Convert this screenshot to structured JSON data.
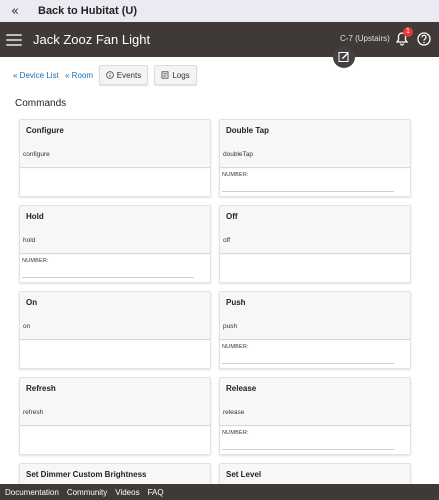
{
  "back_bar": {
    "label": "Back to Hubitat (U)",
    "icon": "chevrons-left-icon"
  },
  "header": {
    "title": "Jack Zooz Fan Light",
    "hub_name": "C-7 (Upstairs)",
    "notification_count": "1",
    "colors": {
      "bar": "#3f3a37",
      "badge": "#e53935"
    }
  },
  "nav": {
    "device_list": "« Device List",
    "room": "« Room"
  },
  "toolbar": {
    "events": "Events",
    "logs": "Logs"
  },
  "commands": {
    "title": "Commands",
    "items": [
      {
        "name": "Configure",
        "method": "configure"
      },
      {
        "name": "Double Tap",
        "method": "doubleTap",
        "arg_label": "NUMBER:",
        "arg_value": ""
      },
      {
        "name": "Hold",
        "method": "hold",
        "arg_label": "NUMBER:",
        "arg_value": ""
      },
      {
        "name": "Off",
        "method": "off"
      },
      {
        "name": "On",
        "method": "on"
      },
      {
        "name": "Push",
        "method": "push",
        "arg_label": "NUMBER:",
        "arg_value": ""
      },
      {
        "name": "Refresh",
        "method": "refresh"
      },
      {
        "name": "Release",
        "method": "release",
        "arg_label": "NUMBER:",
        "arg_value": ""
      },
      {
        "name": "Set Dimmer Custom Brightness"
      },
      {
        "name": "Set Level"
      }
    ]
  },
  "footer": {
    "links": [
      "Documentation",
      "Community",
      "Videos",
      "FAQ"
    ]
  }
}
